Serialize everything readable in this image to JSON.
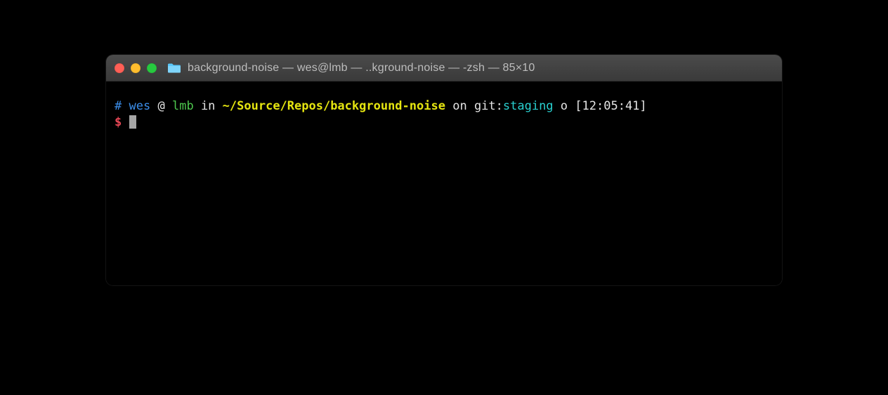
{
  "window": {
    "title": "background-noise — wes@lmb — ..kground-noise — -zsh — 85×10"
  },
  "prompt": {
    "hash": "#",
    "user": "wes",
    "at": "@",
    "host": "lmb",
    "in": "in",
    "path": "~/Source/Repos/background-noise",
    "on": "on",
    "git_label": "git:",
    "git_branch": "staging",
    "git_status": "o",
    "timestamp": "[12:05:41]",
    "dollar": "$"
  }
}
